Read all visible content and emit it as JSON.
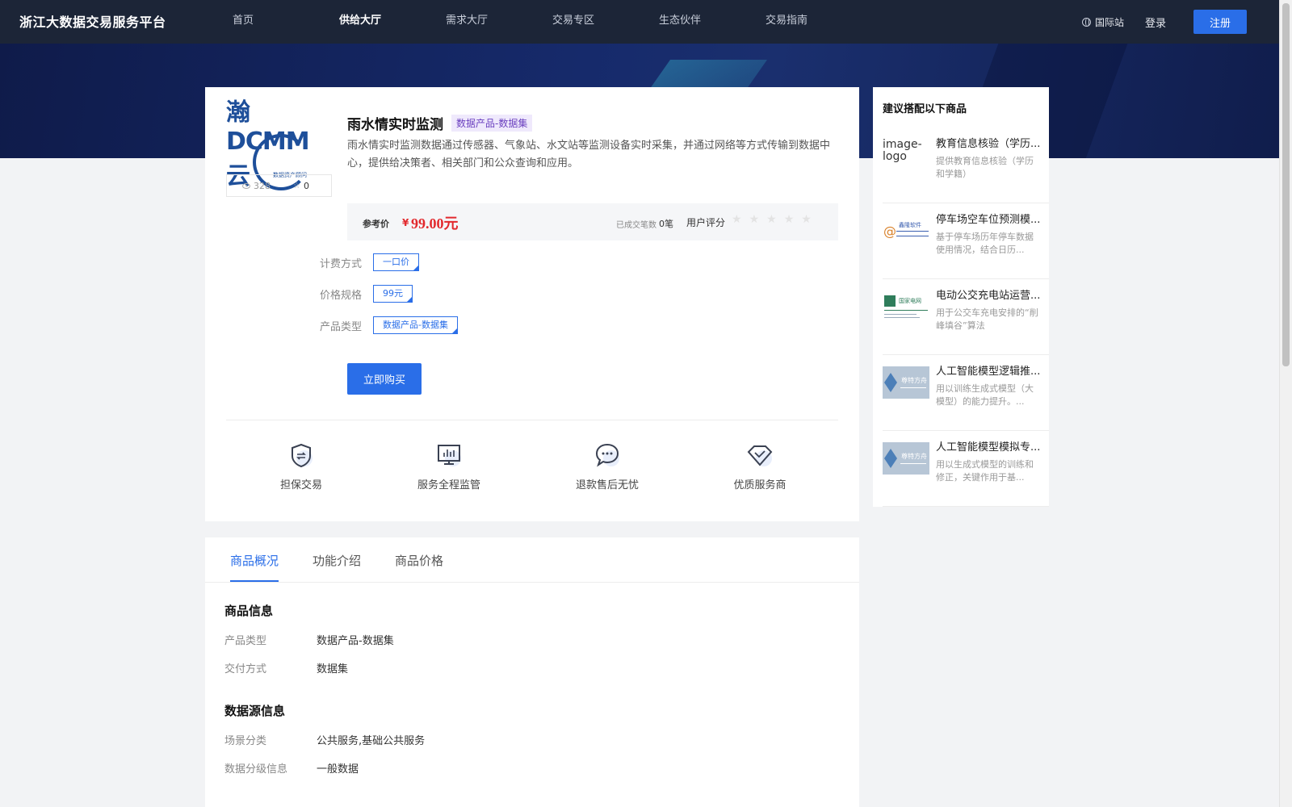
{
  "nav": {
    "brand": "浙江大数据交易服务平台",
    "items": [
      {
        "label": "首页",
        "active": false
      },
      {
        "label": "供给大厅",
        "active": true
      },
      {
        "label": "需求大厅",
        "active": false
      },
      {
        "label": "交易专区",
        "active": false
      },
      {
        "label": "生态伙伴",
        "active": false
      },
      {
        "label": "交易指南",
        "active": false
      }
    ],
    "intl_label": "国际站",
    "login_label": "登录",
    "register_label": "注册"
  },
  "product": {
    "logo_text": "瀚DCMM云",
    "logo_subtext": "数据资产顾问",
    "views": "328",
    "stars": "0",
    "title": "雨水情实时监测",
    "tag": "数据产品-数据集",
    "description": "雨水情实时监测数据通过传感器、气象站、水文站等监测设备实时采集，并通过网络等方式传输到数据中心，提供给决策者、相关部门和公众查询和应用。",
    "price_label": "参考价",
    "price_currency": "¥",
    "price_value": "99.00元",
    "deal_label": "已成交笔数",
    "deal_count": "0笔",
    "rating_label": "用户评分",
    "rating": 0,
    "specs": [
      {
        "label": "计费方式",
        "value": "一口价"
      },
      {
        "label": "价格规格",
        "value": "99元"
      },
      {
        "label": "产品类型",
        "value": "数据产品-数据集"
      }
    ],
    "buy_label": "立即购买",
    "features": [
      {
        "label": "担保交易",
        "icon": "shield-exchange-icon"
      },
      {
        "label": "服务全程监管",
        "icon": "monitor-chart-icon"
      },
      {
        "label": "退款售后无忧",
        "icon": "chat-bubble-icon"
      },
      {
        "label": "优质服务商",
        "icon": "diamond-check-icon"
      }
    ]
  },
  "tabs": [
    {
      "label": "商品概况",
      "active": true
    },
    {
      "label": "功能介绍",
      "active": false
    },
    {
      "label": "商品价格",
      "active": false
    }
  ],
  "details": {
    "goods_info_title": "商品信息",
    "goods_info": [
      {
        "label": "产品类型",
        "value": "数据产品-数据集"
      },
      {
        "label": "交付方式",
        "value": "数据集"
      }
    ],
    "source_info_title": "数据源信息",
    "source_info": [
      {
        "label": "场景分类",
        "value": "公共服务,基础公共服务"
      },
      {
        "label": "数据分级信息",
        "value": "一般数据"
      }
    ]
  },
  "recommendations": {
    "title": "建议搭配以下商品",
    "items": [
      {
        "name": "教育信息核验（学历...",
        "desc": "提供教育信息核验（学历和学籍）",
        "thumb_alt": "image-logo"
      },
      {
        "name": "停车场空车位预测模...",
        "desc": "基于停车场历年停车数据使用情况，结合日历...",
        "thumb_text": "鑫隆软件"
      },
      {
        "name": "电动公交充电站运营...",
        "desc": "用于公交车充电安排的“削峰填谷”算法",
        "thumb_text": "国家电网"
      },
      {
        "name": "人工智能模型逻辑推...",
        "desc": "用以训练生成式模型（大模型）的能力提升。...",
        "thumb_text": "尊特方舟"
      },
      {
        "name": "人工智能模型模拟专...",
        "desc": "用以生成式模型的训练和修正，关键作用于基...",
        "thumb_text": "尊特方舟"
      }
    ]
  }
}
